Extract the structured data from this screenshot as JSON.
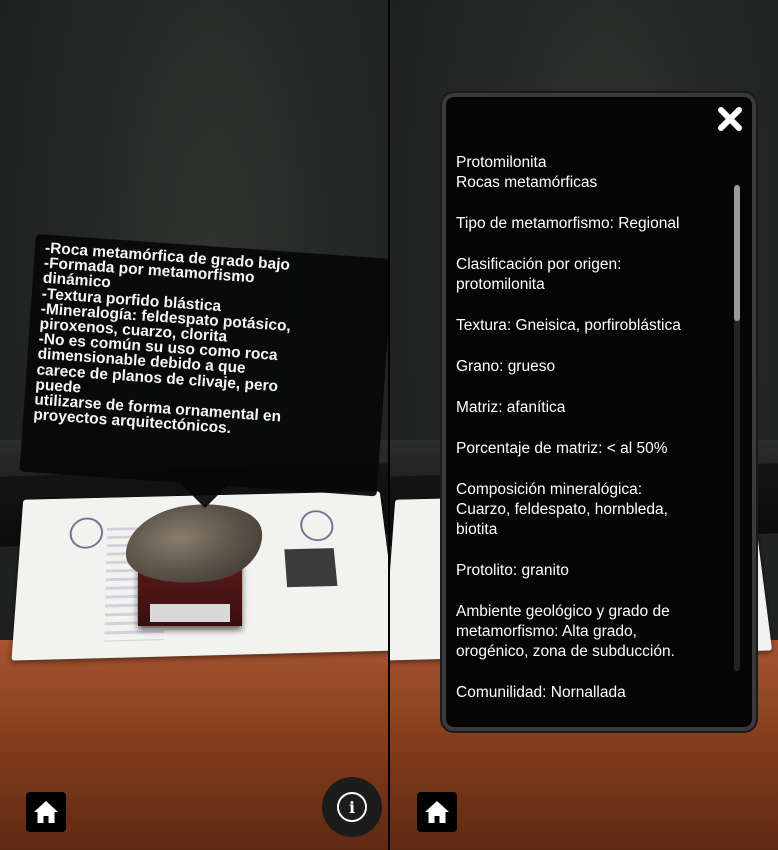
{
  "left_screen": {
    "bubble_lines": [
      "-Roca metamórfica de grado bajo",
      "-Formada por metamorfismo",
      "dinámico",
      "-Textura porfido blástica",
      "-Mineralogía: feldespato potásico,",
      "piroxenos, cuarzo, clorita",
      "-No es común su uso como roca",
      "dimensionable debido a que",
      "carece de planos de clivaje, pero",
      "puede",
      "utilizarse de forma ornamental en",
      "proyectos arquitectónicos."
    ],
    "home_icon": "home-icon",
    "info_icon": "info-icon",
    "info_glyph": "i"
  },
  "right_screen": {
    "close_icon": "close-icon",
    "info_paragraphs": [
      [
        "Protomilonita",
        "Rocas metamórficas"
      ],
      [
        "Tipo de metamorfismo: Regional"
      ],
      [
        "Clasificación por origen:",
        "protomilonita"
      ],
      [
        "Textura: Gneisica, porfiroblástica"
      ],
      [
        "Grano: grueso"
      ],
      [
        "Matriz: afanítica"
      ],
      [
        "Porcentaje de matriz: < al 50%"
      ],
      [
        "Composición mineralógica:",
        "Cuarzo, feldespato, hornbleda,",
        "biotita"
      ],
      [
        "Protolito: granito"
      ],
      [
        "Ambiente geológico y grado de",
        "metamorfismo: Alta grado,",
        "orogénico, zona de subducción."
      ],
      [
        "Comunilidad: Nornallada"
      ]
    ],
    "scroll_position": 0.0,
    "home_icon": "home-icon"
  },
  "colors": {
    "panel_bg": "#050505",
    "panel_border": "#3a3a3a",
    "text": "#ffffff",
    "table": "#a6542f"
  }
}
